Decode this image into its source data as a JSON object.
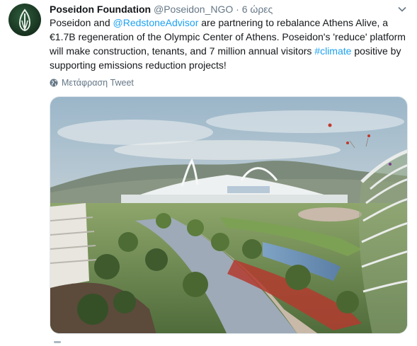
{
  "tweet": {
    "author_name": "Poseidon Foundation",
    "handle": "@Poseidon_NGO",
    "separator": "·",
    "time": "6 ώρες",
    "text_1": "Poseidon and ",
    "mention": "@RedstoneAdvisor",
    "text_2": " are partnering to rebalance Athens Alive, a €1.7B regeneration of the Olympic Center of Athens. Poseidon's 'reduce' platform will make construction, tenants, and 7 million annual visitors ",
    "hashtag": "#climate",
    "text_3": " positive by supporting emissions reduction projects!",
    "translate_label": "Μετάφραση Tweet"
  },
  "icons": {
    "avatar": "leaf-logo-icon",
    "menu": "chevron-down-icon",
    "translate": "globe-icon"
  },
  "colors": {
    "link": "#1da1f2",
    "muted": "#657786",
    "text": "#14171a"
  }
}
